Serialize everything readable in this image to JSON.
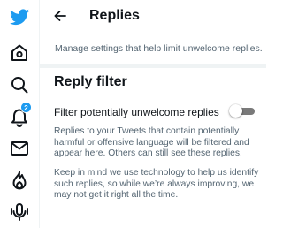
{
  "sidebar": {
    "items": [
      {
        "icon": "twitter-logo-icon",
        "badge": null
      },
      {
        "icon": "home-icon",
        "badge": null
      },
      {
        "icon": "search-icon",
        "badge": null
      },
      {
        "icon": "bell-icon",
        "badge": "2"
      },
      {
        "icon": "mail-icon",
        "badge": null
      },
      {
        "icon": "topics-flame-icon",
        "badge": null
      },
      {
        "icon": "spaces-mic-icon",
        "badge": null
      }
    ]
  },
  "header": {
    "title": "Replies"
  },
  "main": {
    "description": "Manage settings that help limit unwelcome replies.",
    "section_title": "Reply filter",
    "filter_label": "Filter potentially unwelcome replies",
    "filter_enabled": false,
    "paragraph_1": "Replies to your Tweets that contain potentially harmful or offensive language will be filtered and appear here. Others can still see these replies.",
    "paragraph_2": "Keep in mind we use technology to help us identify such replies, so while we’re always improving, we may not get it right all the time."
  },
  "colors": {
    "brand": "#1d9bf0",
    "text_primary": "#0f1419",
    "text_secondary": "#536471",
    "toggle_off": "#7a7a7a"
  }
}
